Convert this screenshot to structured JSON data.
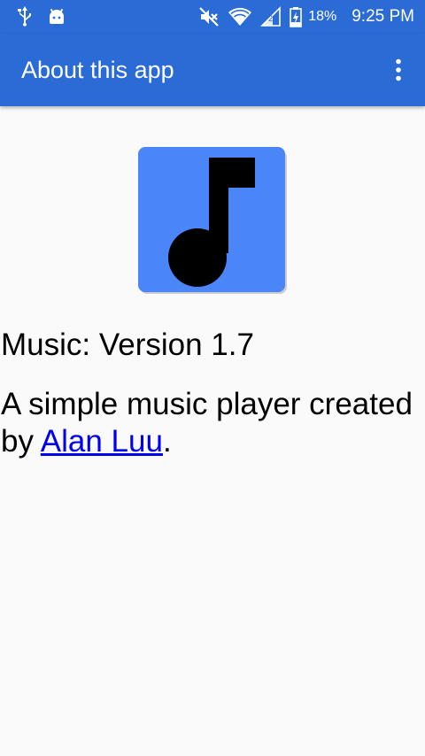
{
  "status_bar": {
    "battery_percent": "18%",
    "time": "9:25 PM",
    "icons": [
      "usb-icon",
      "android-icon",
      "mute-icon",
      "wifi-icon",
      "signal-icon",
      "battery-charging-icon"
    ]
  },
  "app_bar": {
    "title": "About this app",
    "menu_icon": "more-vert-icon"
  },
  "about": {
    "app_icon": "music-note-icon",
    "version_text": "Music: Version 1.7",
    "description_prefix": "A simple music player created by ",
    "author_link_text": "Alan Luu",
    "description_suffix": "."
  },
  "colors": {
    "primary": "#2a6bd6",
    "icon_background": "#4a86f7",
    "link": "#0000ee",
    "background": "#fafafa"
  }
}
